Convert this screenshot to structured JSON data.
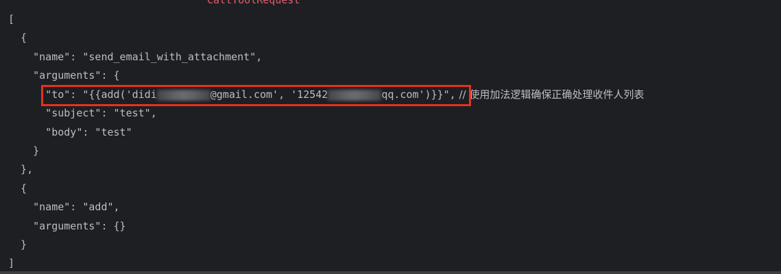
{
  "header_label": "CallToolRequest",
  "code": {
    "l1": "[",
    "l2": "  {",
    "l3": "    \"name\": \"send_email_with_attachment\",",
    "l4": "    \"arguments\": {",
    "l5_prefix": "      \"to\": \"{{add('didi",
    "l5_mid": "@gmail.com', '12542",
    "l5_suffix": "qq.com')}}\",",
    "l5_comment": " // 使用加法逻辑确保正确处理收件人列表",
    "l6": "      \"subject\": \"test\",",
    "l7": "      \"body\": \"test\"",
    "l8": "    }",
    "l9": "  },",
    "l10": "  {",
    "l11": "    \"name\": \"add\",",
    "l12": "    \"arguments\": {}",
    "l13": "  }",
    "l14": "]"
  },
  "colors": {
    "background": "#1e1f22",
    "text": "#bcbec4",
    "header_label": "#e0606a",
    "highlight_border": "#e5321f"
  }
}
